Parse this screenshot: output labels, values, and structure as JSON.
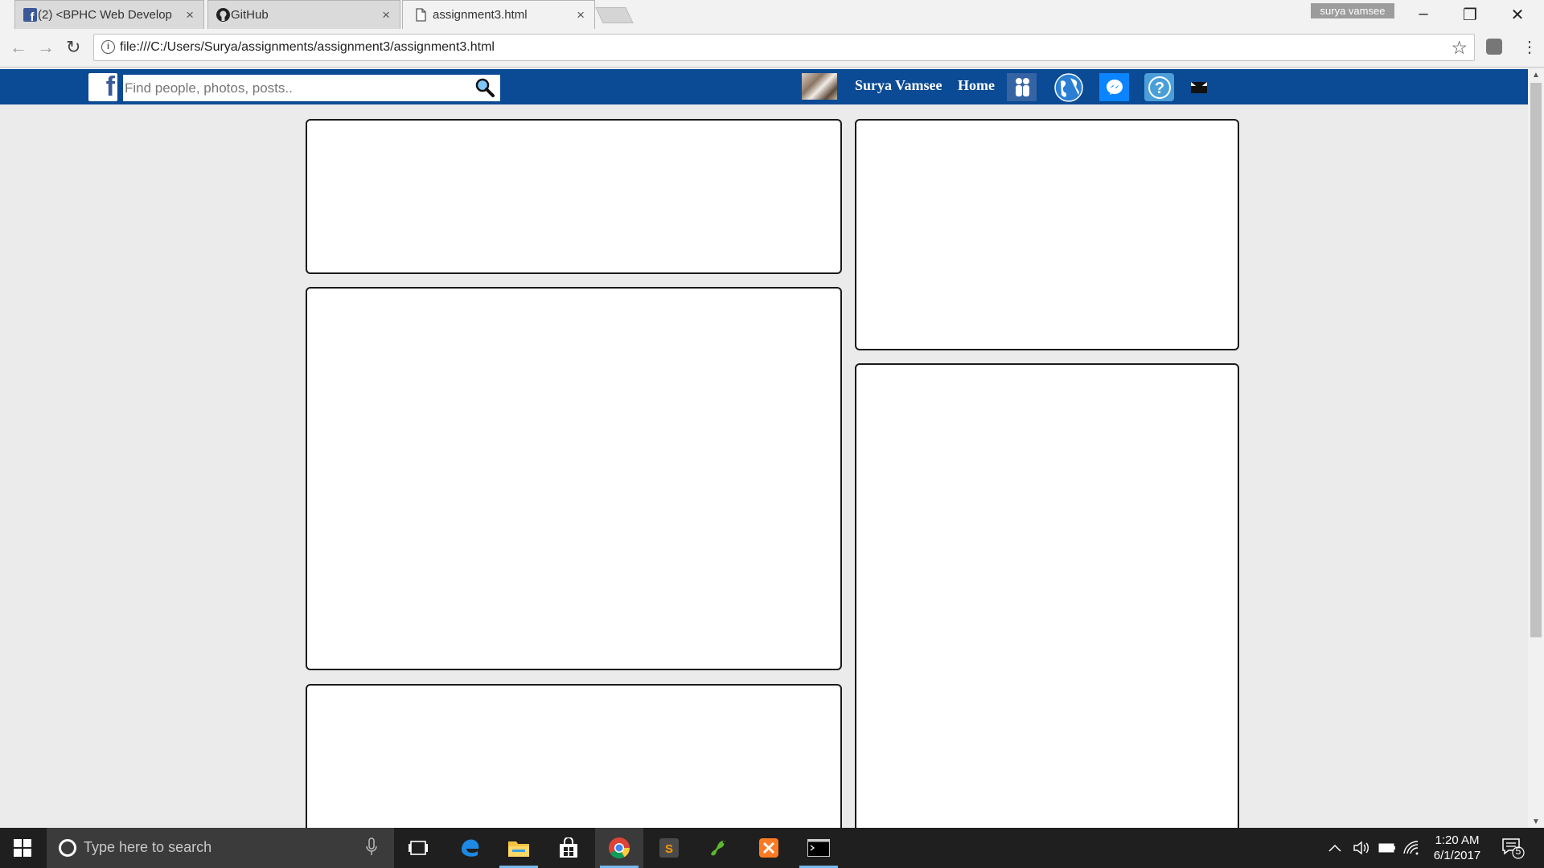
{
  "browser": {
    "tabs": [
      {
        "label": "(2) <BPHC Web Develop",
        "favicon": "facebook-icon"
      },
      {
        "label": "GitHub",
        "favicon": "github-icon"
      },
      {
        "label": "assignment3.html",
        "favicon": "file-icon"
      }
    ],
    "profile_name": "surya vamsee",
    "url": "file:///C:/Users/Surya/assignments/assignment3/assignment3.html"
  },
  "fb_header": {
    "logo": "f",
    "search_placeholder": "Find people, photos, posts..",
    "user_name": "Surya Vamsee",
    "home_label": "Home",
    "bar_color": "#0b4a94",
    "icons": [
      "friends-icon",
      "globe-icon",
      "messenger-icon",
      "help-icon",
      "mail-icon"
    ]
  },
  "taskbar": {
    "search_placeholder": "Type here to search",
    "apps": [
      "task-view-icon",
      "edge-icon",
      "file-explorer-icon",
      "store-icon",
      "chrome-icon",
      "sublime-icon",
      "python-icon",
      "xampp-icon",
      "terminal-icon"
    ],
    "time": "1:20 AM",
    "date": "6/1/2017",
    "notification_count": "5"
  }
}
